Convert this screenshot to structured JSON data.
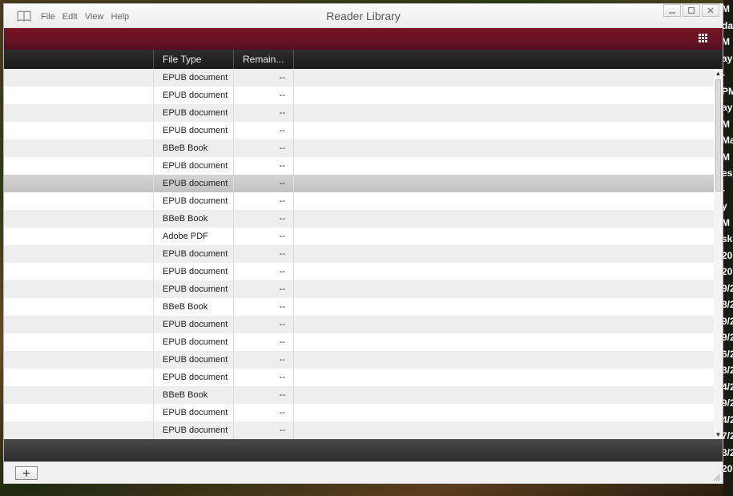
{
  "window": {
    "title": "Reader Library",
    "menu": [
      "File",
      "Edit",
      "View",
      "Help"
    ],
    "controls": {
      "minimize": "—",
      "maximize": "☐",
      "close": "✕"
    }
  },
  "toolbar": {
    "list_view_icon": "list-view-icon",
    "grid_view_icon": "grid-view-icon",
    "active_view": "list"
  },
  "table": {
    "columns": [
      "File Type",
      "Remain..."
    ],
    "selected_index": 6,
    "rows": [
      {
        "file_type": "EPUB document",
        "remaining": "--"
      },
      {
        "file_type": "EPUB document",
        "remaining": "--"
      },
      {
        "file_type": "EPUB document",
        "remaining": "--"
      },
      {
        "file_type": "EPUB document",
        "remaining": "--"
      },
      {
        "file_type": "BBeB Book",
        "remaining": "--"
      },
      {
        "file_type": "EPUB document",
        "remaining": "--"
      },
      {
        "file_type": "EPUB document",
        "remaining": "--"
      },
      {
        "file_type": "EPUB document",
        "remaining": "--"
      },
      {
        "file_type": "BBeB Book",
        "remaining": "--"
      },
      {
        "file_type": "Adobe PDF",
        "remaining": "--"
      },
      {
        "file_type": "EPUB document",
        "remaining": "--"
      },
      {
        "file_type": "EPUB document",
        "remaining": "--"
      },
      {
        "file_type": "EPUB document",
        "remaining": "--"
      },
      {
        "file_type": "BBeB Book",
        "remaining": "--"
      },
      {
        "file_type": "EPUB document",
        "remaining": "--"
      },
      {
        "file_type": "EPUB document",
        "remaining": "--"
      },
      {
        "file_type": "EPUB document",
        "remaining": "--"
      },
      {
        "file_type": "EPUB document",
        "remaining": "--"
      },
      {
        "file_type": "BBeB Book",
        "remaining": "--"
      },
      {
        "file_type": "EPUB document",
        "remaining": "--"
      },
      {
        "file_type": "EPUB document",
        "remaining": "--"
      }
    ]
  },
  "footer": {
    "add_label": "+"
  },
  "desktop_behind": [
    "M",
    "da",
    "M",
    "ay",
    "-",
    "PM",
    "ay",
    "M",
    "Ma",
    "M",
    "es",
    "-",
    "y",
    "M",
    "sk",
    "20",
    "20",
    "9/2",
    "8/2",
    "9/2",
    "9/2",
    "6/2",
    "8/2",
    "4/2",
    "9/2",
    "4/2",
    "7/2",
    "3/2",
    "20"
  ],
  "colors": {
    "accent": "#6b1020",
    "header_bg": "#222222",
    "status_bg": "#3a3a3a"
  }
}
